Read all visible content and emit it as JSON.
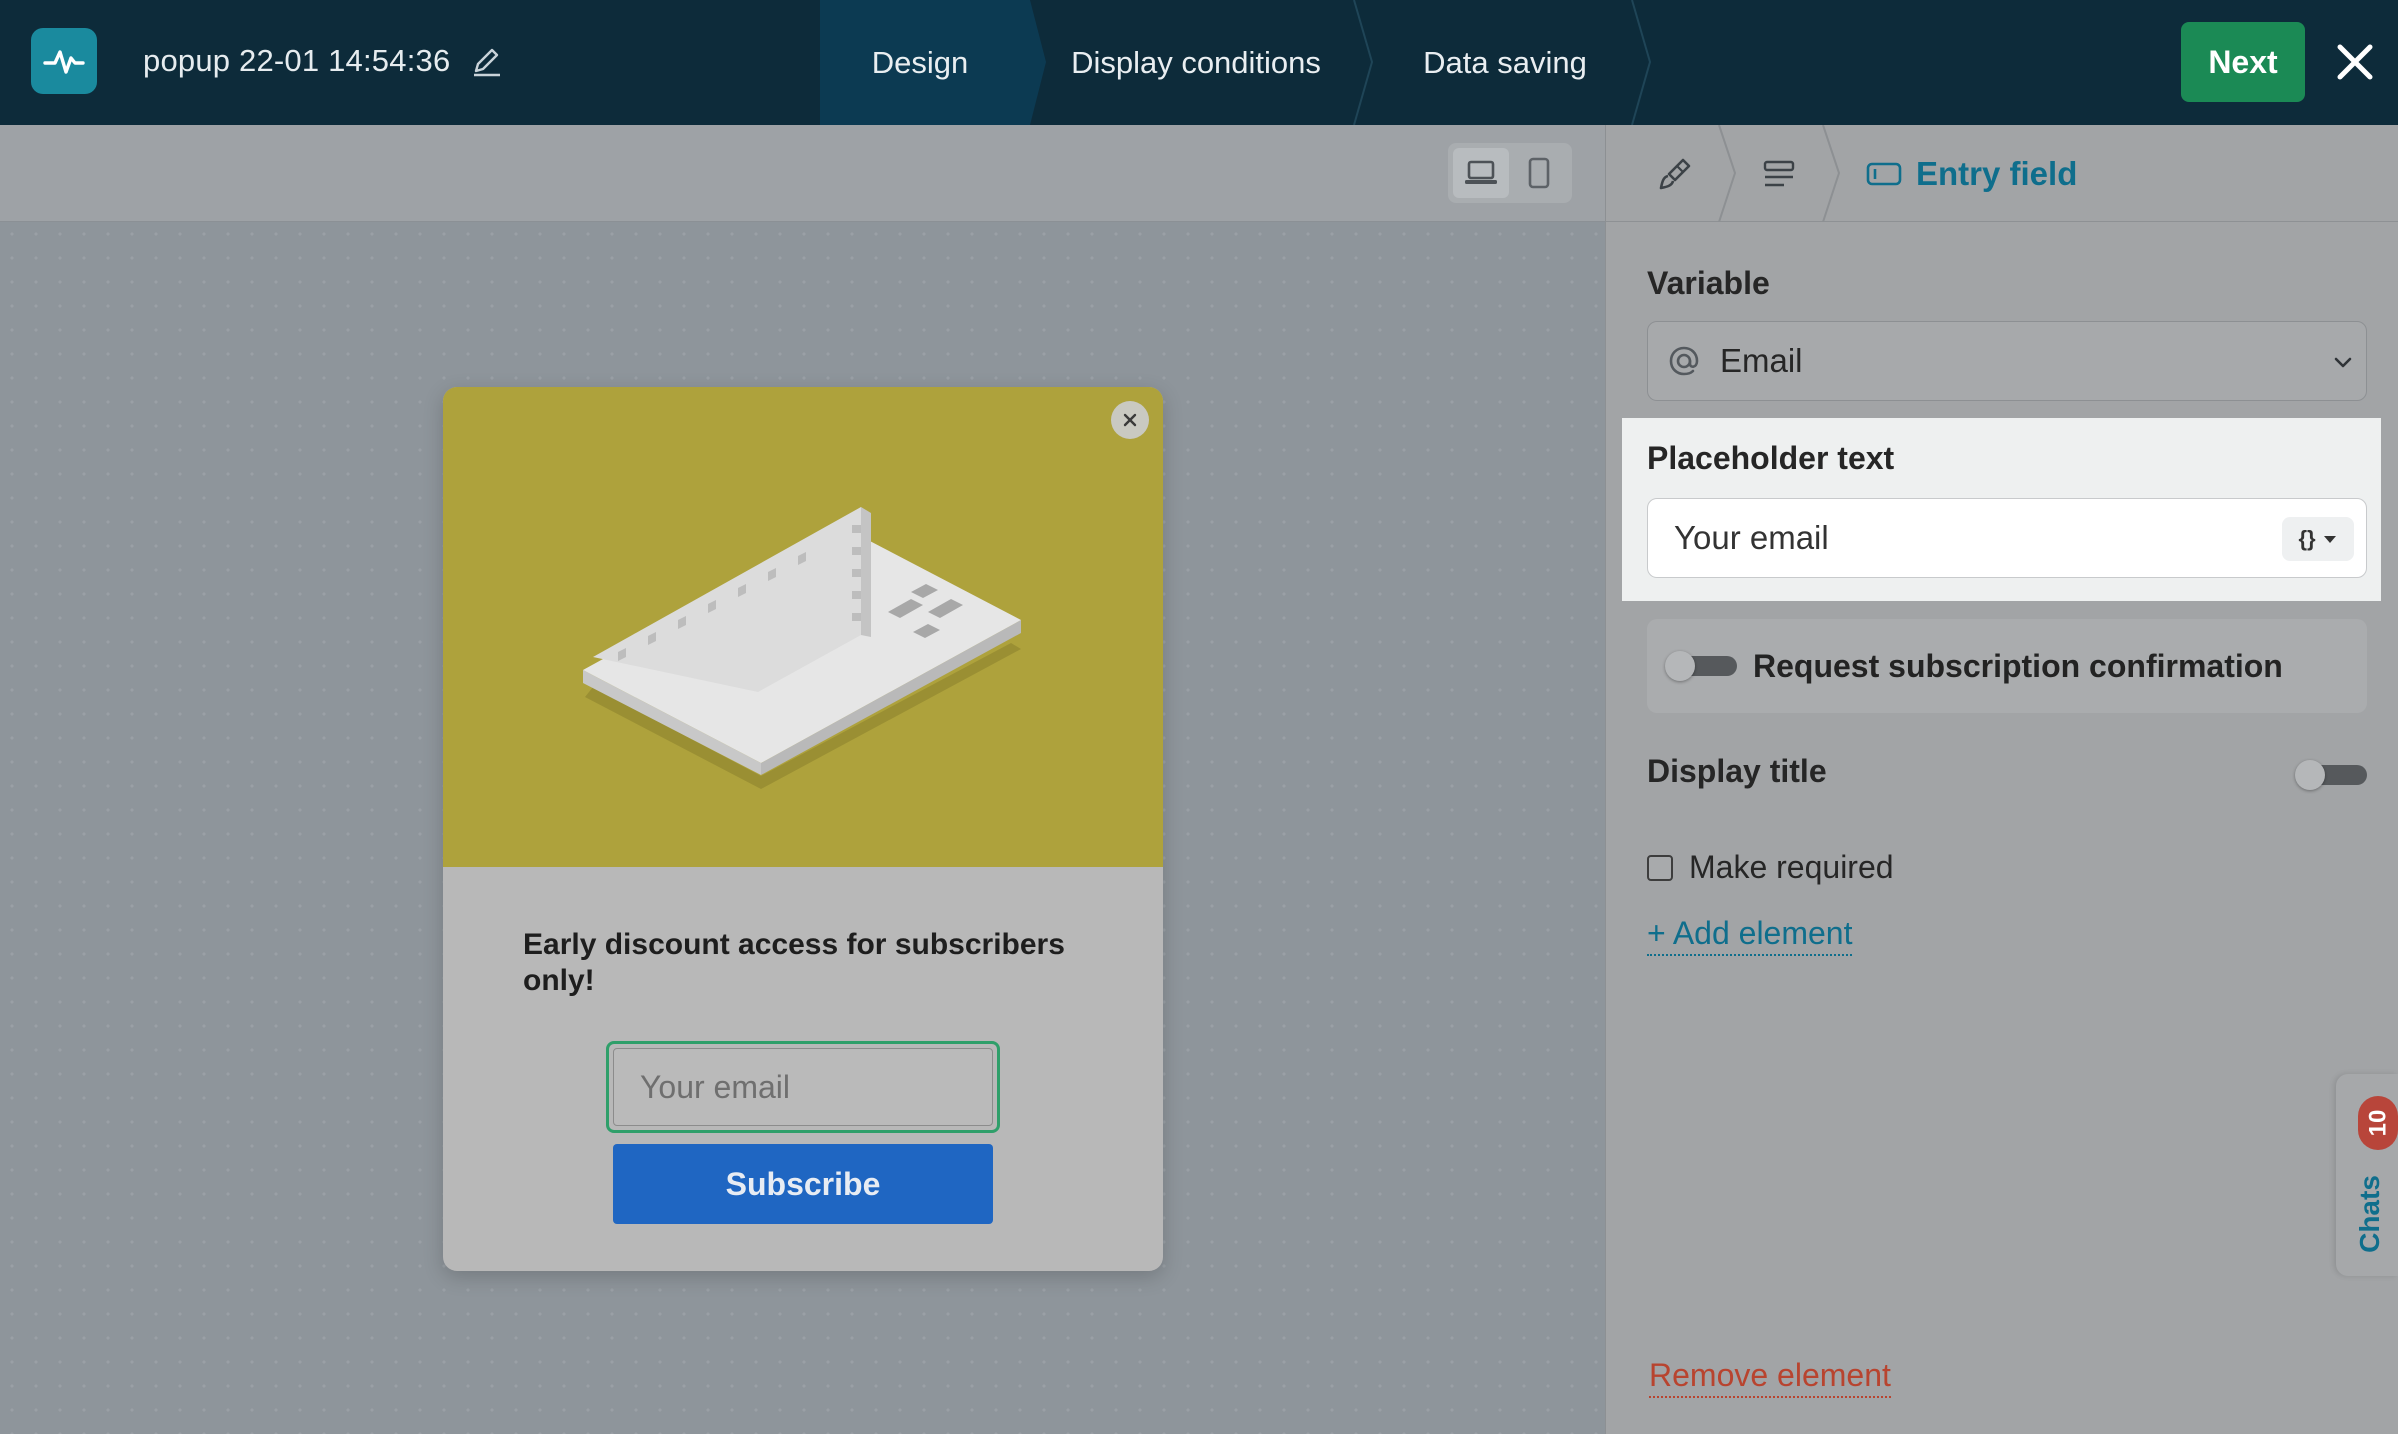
{
  "colors": {
    "topbar": "#0d2b3a",
    "accent": "#0f6e8c",
    "next_button": "#1b8a55",
    "popup_hero": "#aea23c",
    "subscribe_button": "#1f66c2",
    "remove_link": "#b8442f"
  },
  "header": {
    "doc_title": "popup 22-01 14:54:36",
    "steps": [
      {
        "label": "Design",
        "active": true
      },
      {
        "label": "Display conditions",
        "active": false
      },
      {
        "label": "Data saving",
        "active": false
      }
    ],
    "next_label": "Next"
  },
  "icons": {
    "logo": "pulse-logo-icon",
    "rename": "pencil-icon",
    "close": "close-icon",
    "desktop": "laptop-icon",
    "mobile": "phone-icon",
    "crumb_style": "brush-icon",
    "crumb_form": "form-icon",
    "crumb_entry": "entry-field-icon",
    "variable": "at-sign-icon",
    "dropdown": "chevron-down-icon"
  },
  "popup": {
    "heading": "Early discount access for subscribers only!",
    "input_placeholder": "Your email",
    "button_label": "Subscribe"
  },
  "panel": {
    "breadcrumb_active": "Entry field",
    "variable_label": "Variable",
    "variable_value": "Email",
    "placeholder_label": "Placeholder text",
    "placeholder_value": "Your email",
    "var_button": "{}",
    "subscription_toggle_label": "Request subscription confirmation",
    "subscription_toggle_on": false,
    "display_title_label": "Display title",
    "display_title_on": false,
    "make_required_label": "Make required",
    "make_required_checked": false,
    "add_element": "+ Add element",
    "remove_element": "Remove element"
  },
  "chats": {
    "label": "Chats",
    "count": "10"
  }
}
